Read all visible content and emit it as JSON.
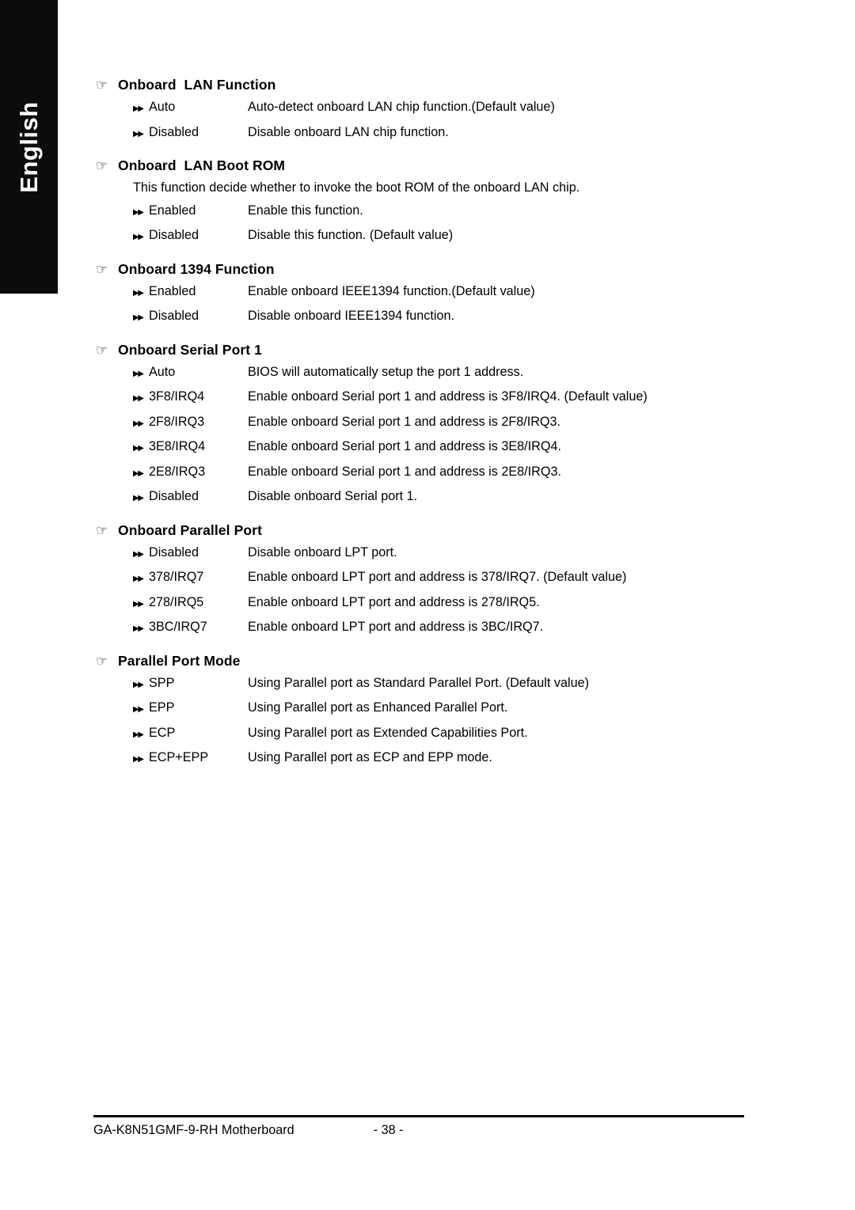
{
  "sidebar": {
    "language_label": "English"
  },
  "icons": {
    "hand": "☞",
    "arrow": "▶▶"
  },
  "sections": [
    {
      "heading": "Onboard  LAN Function",
      "note": "",
      "options": [
        {
          "name": "Auto",
          "desc": "Auto-detect onboard LAN chip function.(Default value)"
        },
        {
          "name": "Disabled",
          "desc": "Disable onboard LAN chip function."
        }
      ]
    },
    {
      "heading": "Onboard  LAN Boot ROM",
      "note": "This function decide whether to invoke the boot ROM of the onboard LAN chip.",
      "options": [
        {
          "name": "Enabled",
          "desc": "Enable this function."
        },
        {
          "name": "Disabled",
          "desc": "Disable this function. (Default value)"
        }
      ]
    },
    {
      "heading": "Onboard 1394 Function",
      "note": "",
      "options": [
        {
          "name": "Enabled",
          "desc": "Enable onboard IEEE1394 function.(Default value)"
        },
        {
          "name": "Disabled",
          "desc": "Disable onboard IEEE1394 function."
        }
      ]
    },
    {
      "heading": "Onboard Serial Port 1",
      "note": "",
      "options": [
        {
          "name": "Auto",
          "desc": "BIOS will automatically setup the port 1 address."
        },
        {
          "name": "3F8/IRQ4",
          "desc": "Enable onboard Serial port 1 and address is 3F8/IRQ4. (Default value)"
        },
        {
          "name": "2F8/IRQ3",
          "desc": "Enable onboard Serial port 1 and address is 2F8/IRQ3."
        },
        {
          "name": "3E8/IRQ4",
          "desc": "Enable onboard Serial port 1 and address is 3E8/IRQ4."
        },
        {
          "name": "2E8/IRQ3",
          "desc": "Enable onboard Serial port 1 and address is 2E8/IRQ3."
        },
        {
          "name": "Disabled",
          "desc": "Disable onboard Serial port 1."
        }
      ]
    },
    {
      "heading": "Onboard Parallel Port",
      "note": "",
      "options": [
        {
          "name": "Disabled",
          "desc": "Disable onboard LPT port."
        },
        {
          "name": "378/IRQ7",
          "desc": "Enable onboard LPT port and address is 378/IRQ7. (Default value)"
        },
        {
          "name": "278/IRQ5",
          "desc": "Enable onboard LPT port and address is 278/IRQ5."
        },
        {
          "name": "3BC/IRQ7",
          "desc": "Enable onboard LPT port and address is 3BC/IRQ7."
        }
      ]
    },
    {
      "heading": "Parallel Port Mode",
      "note": "",
      "options": [
        {
          "name": "SPP",
          "desc": "Using Parallel port as Standard Parallel Port. (Default value)"
        },
        {
          "name": "EPP",
          "desc": "Using Parallel port as Enhanced Parallel Port."
        },
        {
          "name": "ECP",
          "desc": "Using Parallel port as Extended Capabilities Port."
        },
        {
          "name": "ECP+EPP",
          "desc": "Using Parallel port as ECP and EPP mode."
        }
      ]
    }
  ],
  "footer": {
    "product": "GA-K8N51GMF-9-RH Motherboard",
    "page_number": "- 38 -"
  }
}
